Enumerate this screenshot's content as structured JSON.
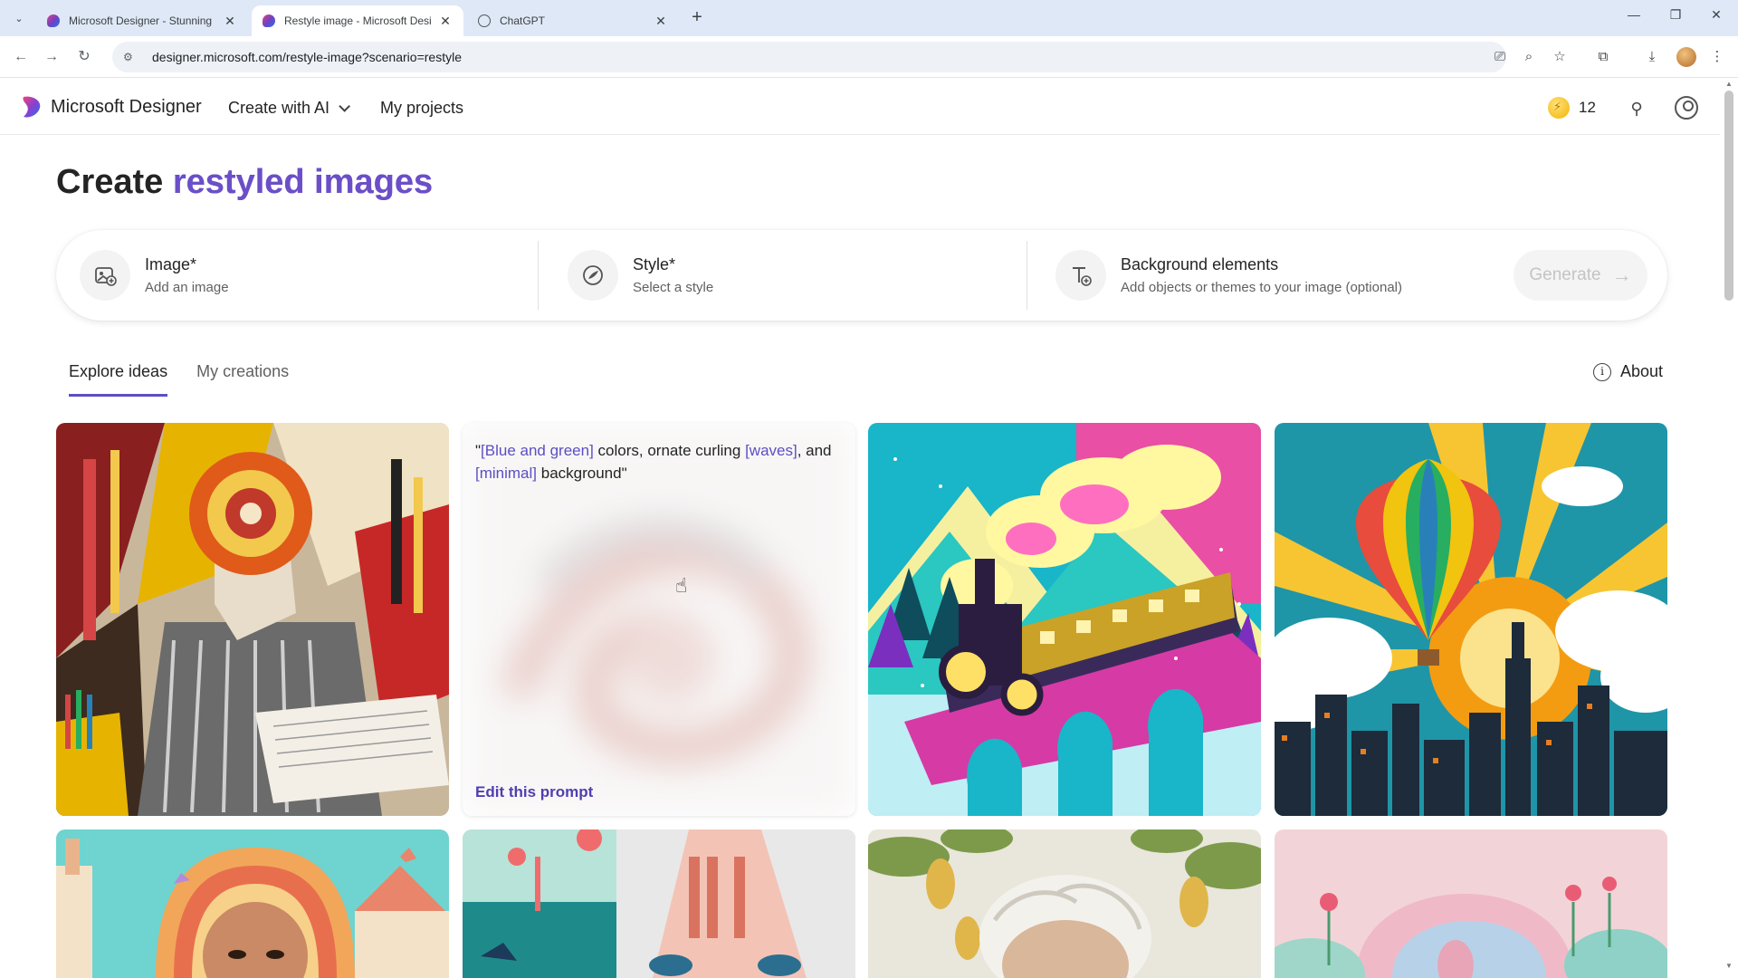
{
  "browser": {
    "tabs": [
      {
        "title": "Microsoft Designer - Stunning",
        "active": false
      },
      {
        "title": "Restyle image - Microsoft Desi",
        "active": true
      },
      {
        "title": "ChatGPT",
        "active": false
      }
    ],
    "url": "designer.microsoft.com/restyle-image?scenario=restyle"
  },
  "header": {
    "brand": "Microsoft Designer",
    "create_with_ai": "Create with AI",
    "my_projects": "My projects",
    "credits": "12"
  },
  "page": {
    "title_prefix": "Create",
    "title_highlight": "restyled images",
    "segments": [
      {
        "title": "Image*",
        "subtitle": "Add an image"
      },
      {
        "title": "Style*",
        "subtitle": "Select a style"
      },
      {
        "title": "Background elements",
        "subtitle": "Add objects or themes to your image (optional)"
      }
    ],
    "generate_label": "Generate",
    "tabs": [
      {
        "label": "Explore ideas",
        "active": true
      },
      {
        "label": "My creations",
        "active": false
      }
    ],
    "about_label": "About"
  },
  "prompt_card": {
    "parts": [
      {
        "text": "\"",
        "hl": false
      },
      {
        "text": "[Blue and green]",
        "hl": true
      },
      {
        "text": " colors, ornate curling ",
        "hl": false
      },
      {
        "text": "[waves]",
        "hl": true
      },
      {
        "text": ", and ",
        "hl": false
      },
      {
        "text": "[minimal]",
        "hl": true
      },
      {
        "text": " background\"",
        "hl": false
      }
    ],
    "edit_label": "Edit this prompt"
  },
  "colors": {
    "accent": "#5b4fc4",
    "accent_dark": "#4f3fb0"
  }
}
